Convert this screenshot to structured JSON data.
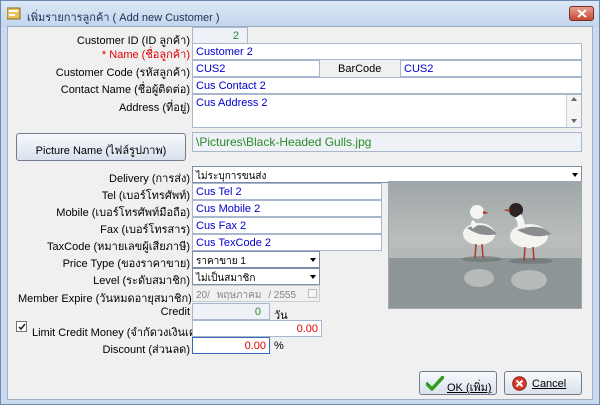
{
  "window": {
    "title": "เพิ่มรายการลูกค้า ( Add new Customer )",
    "accent": "#c9d9ee",
    "close_icon": "close-icon"
  },
  "form": {
    "customer_id": {
      "label": "Customer ID (ID ลูกค้า)",
      "value": "2"
    },
    "name": {
      "label": "* Name (ชื่อลูกค้า)",
      "value": "Customer 2"
    },
    "customer_code": {
      "label": "Customer Code (รหัสลูกค้า)",
      "value": "CUS2"
    },
    "barcode": {
      "label": "BarCode",
      "value": "CUS2"
    },
    "contact_name": {
      "label": "Contact Name (ชื่อผู้ติดต่อ)",
      "value": "Cus Contact 2"
    },
    "address": {
      "label": "Address (ที่อยู่)",
      "value": "Cus Address 2"
    },
    "picture": {
      "button_label": "Picture Name (ไฟล์รูปภาพ)",
      "path": "\\Pictures\\Black-Headed Gulls.jpg"
    },
    "delivery": {
      "label": "Delivery (การส่ง)",
      "value": "ไม่ระบุการขนส่ง"
    },
    "tel": {
      "label": "Tel (เบอร์โทรศัพท์)",
      "value": "Cus Tel 2"
    },
    "mobile": {
      "label": "Mobile (เบอร์โทรศัพท์มือถือ)",
      "value": "Cus Mobile 2"
    },
    "fax": {
      "label": "Fax (เบอร์โทรสาร)",
      "value": "Cus Fax 2"
    },
    "taxcode": {
      "label": "TaxCode (หมายเลขผู้เสียภาษี)",
      "value": "Cus TexCode 2"
    },
    "price_type": {
      "label": "Price Type (ของราคาขาย)",
      "value": "ราคาขาย 1"
    },
    "level": {
      "label": "Level (ระดับสมาชิก)",
      "value": "ไม่เป็นสมาชิก"
    },
    "member_expire": {
      "label": "Member Expire (วันหมดอายุสมาชิก)",
      "day": "20/",
      "month": "พฤษภาคม",
      "year": "/ 2555"
    },
    "credit": {
      "label": "Credit",
      "value": "0",
      "unit": "วัน"
    },
    "limit_credit": {
      "label": "Limit Credit Money (จำกัดวงเงินเครดิต)",
      "value": "0.00",
      "checked": true
    },
    "discount": {
      "label": "Discount (ส่วนลด)",
      "value": "0.00",
      "unit": "%"
    }
  },
  "buttons": {
    "ok_label": "OK (เพิ่ม)",
    "cancel_label": "Cancel"
  }
}
